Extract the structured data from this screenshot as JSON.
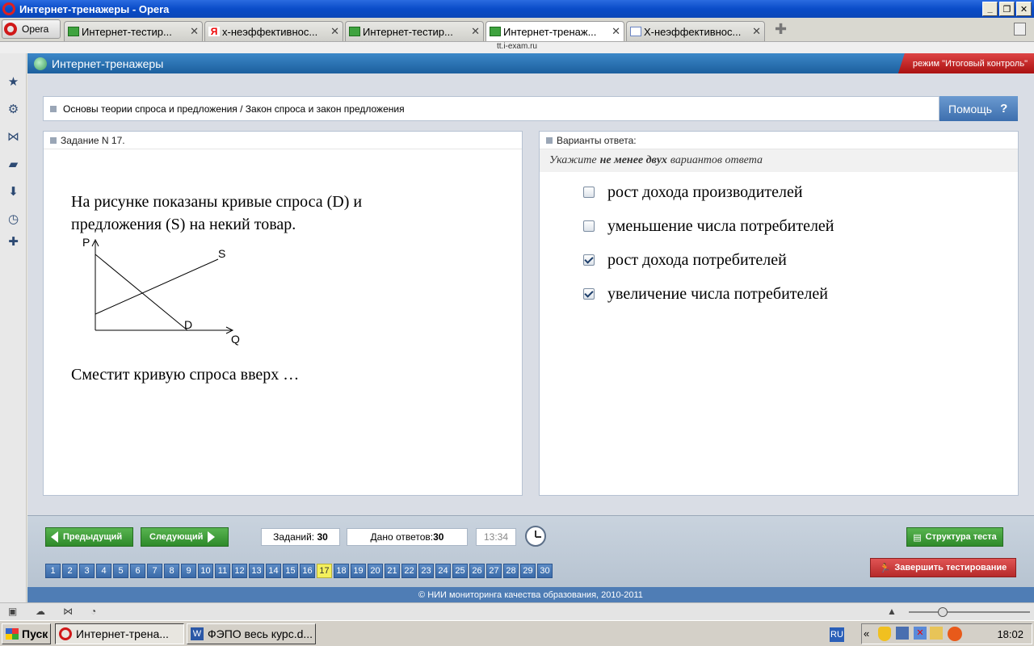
{
  "window": {
    "title": "Интернет-тренажеры - Opera",
    "opera_menu": "Opera",
    "url_hint": "tt.i-exam.ru"
  },
  "tabs": [
    {
      "label": "Интернет-тестир...",
      "icon": "green-book-icon",
      "active": false
    },
    {
      "label": "х-неэффективнос...",
      "icon": "yandex-icon",
      "active": false
    },
    {
      "label": "Интернет-тестир...",
      "icon": "green-book-icon",
      "active": false
    },
    {
      "label": "Интернет-тренаж...",
      "icon": "green-book-icon",
      "active": true
    },
    {
      "label": "Х-неэффективнос...",
      "icon": "document-icon",
      "active": false
    }
  ],
  "app": {
    "title": "Интернет-тренажеры",
    "mode": "режим \"Итоговый контроль\""
  },
  "breadcrumb": "Основы теории спроса и предложения / Закон спроса и закон предложения",
  "help_label": "Помощь",
  "help_q": "?",
  "task": {
    "header": "Задание N 17.",
    "text": "На рисунке показаны кривые спроса (D) и предложения (S) на некий товар.",
    "question": "Сместит кривую спроса вверх …",
    "graph": {
      "p": "P",
      "q": "Q",
      "s": "S",
      "d": "D"
    }
  },
  "answers": {
    "header": "Варианты ответа:",
    "hint_pre": "Укажите",
    "hint_bold": "не менее двух",
    "hint_post": "вариантов ответа",
    "options": [
      {
        "label": "рост дохода производителей",
        "checked": false
      },
      {
        "label": "уменьшение числа потребителей",
        "checked": false
      },
      {
        "label": "рост дохода потребителей",
        "checked": true
      },
      {
        "label": "увеличение числа потребителей",
        "checked": true
      }
    ]
  },
  "nav": {
    "prev": "Предыдущий",
    "next": "Следующий",
    "tasks_label": "Заданий:",
    "tasks_count": "30",
    "answered_label": "Дано ответов:",
    "answered_count": "30",
    "time": "13:34",
    "structure": "Структура теста",
    "finish": "Завершить тестирование",
    "current": 17,
    "numbers": [
      "1",
      "2",
      "3",
      "4",
      "5",
      "6",
      "7",
      "8",
      "9",
      "10",
      "11",
      "12",
      "13",
      "14",
      "15",
      "16",
      "17",
      "18",
      "19",
      "20",
      "21",
      "22",
      "23",
      "24",
      "25",
      "26",
      "27",
      "28",
      "29",
      "30"
    ]
  },
  "copyright": "© НИИ мониторинга качества образования, 2010-2011",
  "taskbar": {
    "start": "Пуск",
    "tasks": [
      "Интернет-трена...",
      "ФЭПО весь курс.d..."
    ],
    "lang": "RU",
    "time": "18:02"
  },
  "colors": {
    "header_blue": "#1C5F9E",
    "mode_red": "#B62A2A",
    "button_green": "#2E8A2A",
    "current_yellow": "#F4EF5C"
  }
}
